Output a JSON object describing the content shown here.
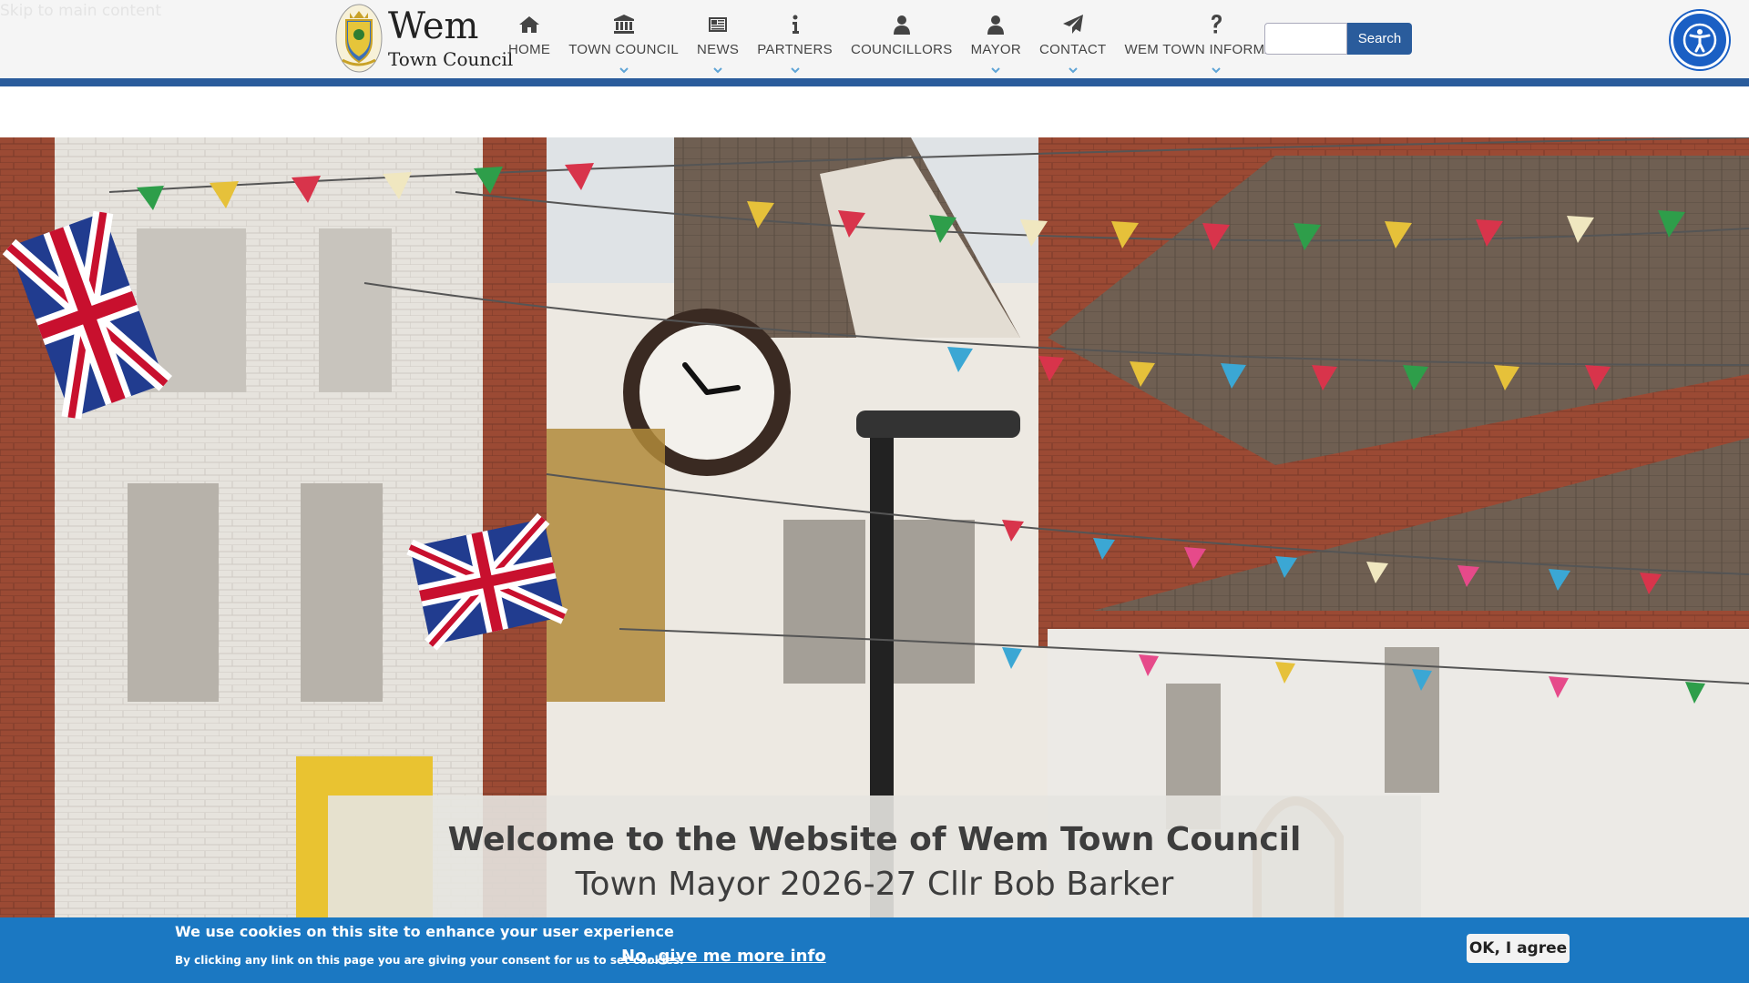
{
  "skip_link": "Skip to main content",
  "logo": {
    "title": "Wem",
    "subtitle": "Town Council"
  },
  "nav": [
    {
      "label": "HOME",
      "icon": "home-icon",
      "dropdown": false
    },
    {
      "label": "TOWN COUNCIL",
      "icon": "building-icon",
      "dropdown": true
    },
    {
      "label": "NEWS",
      "icon": "newspaper-icon",
      "dropdown": true
    },
    {
      "label": "PARTNERS",
      "icon": "info-icon",
      "dropdown": true
    },
    {
      "label": "COUNCILLORS",
      "icon": "user-icon",
      "dropdown": false
    },
    {
      "label": "MAYOR",
      "icon": "user-icon",
      "dropdown": true
    },
    {
      "label": "CONTACT",
      "icon": "paper-plane-icon",
      "dropdown": true
    },
    {
      "label": "WEM TOWN INFORMATION",
      "icon": "question-icon",
      "dropdown": true
    }
  ],
  "search": {
    "placeholder": "",
    "button_label": "Search"
  },
  "hero": {
    "title": "Welcome to the Website of Wem Town Council",
    "subtitle": "Town Mayor 2026-27 Cllr Bob Barker"
  },
  "cookie": {
    "title": "We use cookies on this site to enhance your user experience",
    "text": "By clicking any link on this page you are giving your consent for us to set cookies.",
    "more_info": "No, give me more info",
    "agree": "OK, I agree"
  },
  "colors": {
    "brand_blue": "#2a5c9c",
    "cookie_blue": "#1b78c2",
    "accessibility_blue": "#1a5fc4"
  }
}
